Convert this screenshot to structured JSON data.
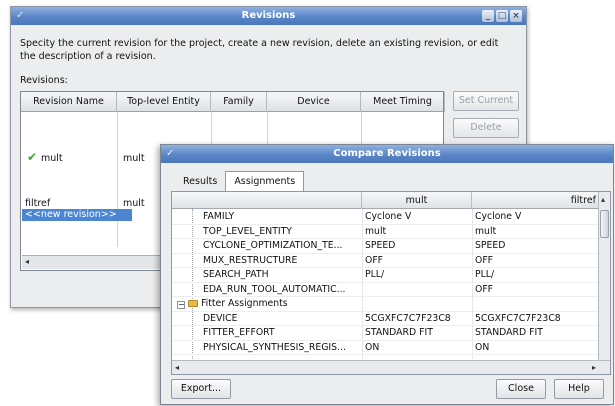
{
  "revisions_window": {
    "title": "Revisions",
    "description": "Specity the current revision for the project, create a new revision, delete an existing revision, or edit the description of a revision.",
    "revisions_label": "Revisions:",
    "columns": [
      "Revision Name",
      "Top-level Entity",
      "Family",
      "Device",
      "Meet Timing"
    ],
    "rows": [
      {
        "name": "mult",
        "entity": "mult",
        "current": true
      },
      {
        "name": "filtref",
        "entity": "mult",
        "current": false
      },
      {
        "name": "<<new revision>>",
        "entity": "",
        "current": false
      }
    ],
    "buttons": {
      "set_current": "Set Current",
      "delete": "Delete"
    },
    "icons": {
      "check": "checkmark-icon"
    },
    "colors": {
      "check": "#3ea82b",
      "selection": "#4c86d2"
    }
  },
  "compare_window": {
    "title": "Compare Revisions",
    "tabs": [
      "Results",
      "Assignments"
    ],
    "active_tab": "Assignments",
    "columns": [
      "",
      "mult",
      "filtref"
    ],
    "rows": [
      {
        "name": "FAMILY",
        "a": "Cyclone V",
        "b": "Cyclone V"
      },
      {
        "name": "TOP_LEVEL_ENTITY",
        "a": "mult",
        "b": "mult"
      },
      {
        "name": "CYCLONE_OPTIMIZATION_TE...",
        "a": "SPEED",
        "b": "SPEED"
      },
      {
        "name": "MUX_RESTRUCTURE",
        "a": "OFF",
        "b": "OFF"
      },
      {
        "name": "SEARCH_PATH",
        "a": "PLL/",
        "b": "PLL/"
      },
      {
        "name": "EDA_RUN_TOOL_AUTOMATIC...",
        "a": "",
        "b": "OFF"
      },
      {
        "name": "Fitter Assignments",
        "a": "",
        "b": "",
        "group": true
      },
      {
        "name": "DEVICE",
        "a": "5CGXFC7C7F23C8",
        "b": "5CGXFC7C7F23C8"
      },
      {
        "name": "FITTER_EFFORT",
        "a": "STANDARD FIT",
        "b": "STANDARD FIT"
      },
      {
        "name": "PHYSICAL_SYNTHESIS_REGIS...",
        "a": "ON",
        "b": "ON"
      }
    ],
    "buttons": {
      "export": "Export...",
      "close": "Close",
      "help": "Help"
    }
  }
}
